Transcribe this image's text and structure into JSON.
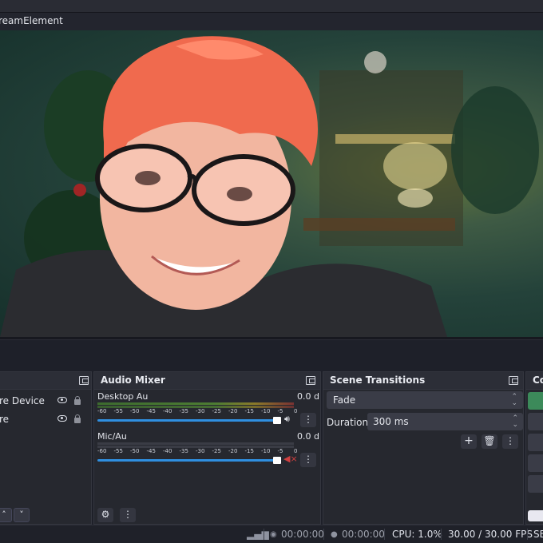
{
  "window": {
    "title": "reamElement"
  },
  "sources": {
    "items": [
      {
        "label": "re Device"
      },
      {
        "label": "re"
      }
    ],
    "up_icon": "chevron-up-icon",
    "down_icon": "chevron-down-icon"
  },
  "audio_mixer": {
    "title": "Audio Mixer",
    "ticks": [
      "-60",
      "-55",
      "-50",
      "-45",
      "-40",
      "-35",
      "-30",
      "-25",
      "-20",
      "-15",
      "-10",
      "-5",
      "0"
    ],
    "channels": [
      {
        "name": "Desktop Au",
        "db": "0.0 d",
        "volume": 1.0,
        "muted": false
      },
      {
        "name": "Mic/Au",
        "db": "0.0 d",
        "volume": 1.0,
        "muted": true
      }
    ]
  },
  "scene_transitions": {
    "title": "Scene Transitions",
    "selected": "Fade",
    "duration_label": "Duration",
    "duration_value": "300 ms"
  },
  "controls": {
    "title": "Co"
  },
  "status_bar": {
    "rec_time_1": "00:00:00",
    "rec_time_2": "00:00:00",
    "cpu": "CPU: 1.0%",
    "fps": "30.00 / 30.00 FPS",
    "extra": "SE"
  },
  "colors": {
    "accent": "#2f8fe0",
    "controls_accent": "#3c8a5a",
    "mute_red": "#d04040"
  }
}
